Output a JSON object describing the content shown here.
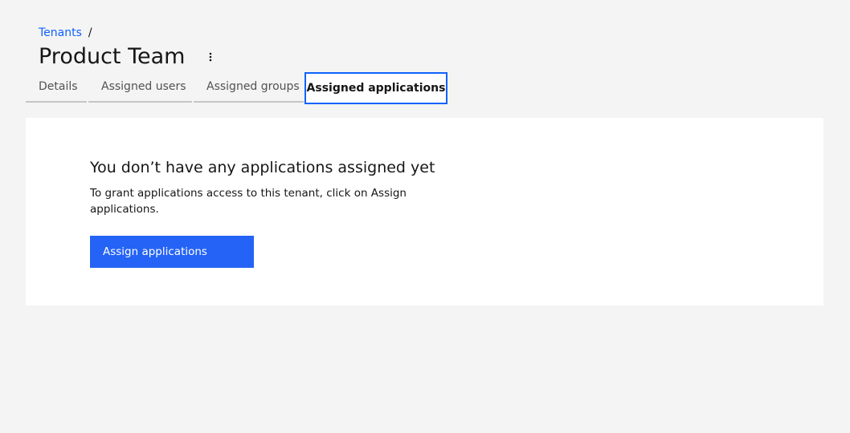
{
  "breadcrumb": {
    "items": [
      {
        "label": "Tenants"
      }
    ],
    "separator": "/"
  },
  "page": {
    "title": "Product Team",
    "overflow_icon": "overflow-menu-vertical-icon"
  },
  "tabs": [
    {
      "label": "Details",
      "selected": false
    },
    {
      "label": "Assigned users",
      "selected": false
    },
    {
      "label": "Assigned groups",
      "selected": false
    },
    {
      "label": "Assigned applications",
      "selected": true
    }
  ],
  "empty_state": {
    "title": "You don’t have any applications assigned yet",
    "description": "To grant applications access to this tenant, click on Assign applications.",
    "button_label": "Assign applications"
  },
  "colors": {
    "accent": "#0f62fe",
    "primary_button": "#2563f6",
    "background": "#f4f4f4"
  }
}
